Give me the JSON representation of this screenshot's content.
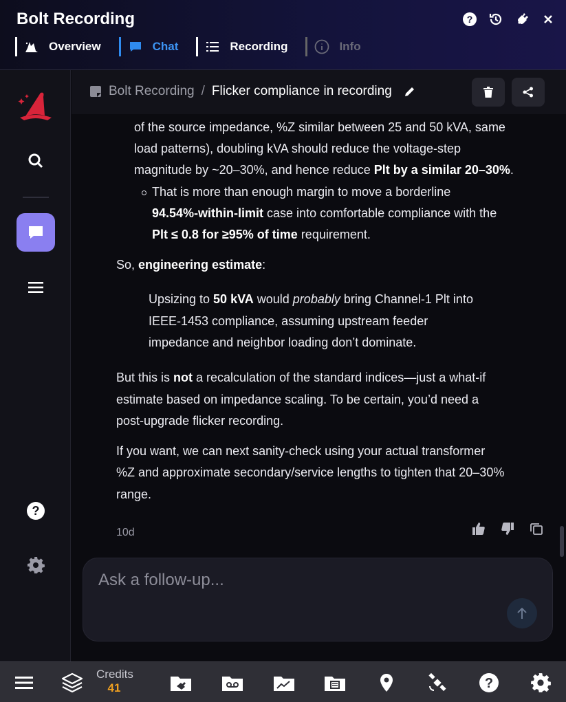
{
  "header": {
    "title": "Bolt Recording",
    "tabs": [
      {
        "label": "Overview",
        "icon": "wizard-hat-icon"
      },
      {
        "label": "Chat",
        "icon": "chat-bubble-icon"
      },
      {
        "label": "Recording",
        "icon": "list-icon"
      },
      {
        "label": "Info",
        "icon": "info-icon"
      }
    ],
    "icons": [
      "help-icon",
      "history-icon",
      "plug-icon",
      "close-icon"
    ]
  },
  "sidebar": {
    "items": [
      "logo-hat-icon",
      "search-icon",
      "chat-icon",
      "menu-icon",
      "help-icon",
      "settings-icon"
    ]
  },
  "breadcrumb": {
    "root": "Bolt Recording",
    "separator": "/",
    "current": "Flicker compliance in recording"
  },
  "message": {
    "l1": "of the source impedance, %Z similar between 25 and 50 kVA, same",
    "l2": "load patterns), doubling kVA should reduce the voltage-step",
    "l3a": "magnitude by ~20–30%, and hence reduce ",
    "l3b": "Plt by a similar 20–30%",
    "l3c": ".",
    "b1": "That is more than enough margin to move a borderline",
    "b2a": "94.54%-within-limit",
    "b2b": " case into comfortable compliance with the",
    "b3a": "Plt ≤ 0.8 for ≥95% of time",
    "b3b": " requirement.",
    "so_a": "So, ",
    "so_b": "engineering estimate",
    "so_c": ":",
    "q1a": "Upsizing to ",
    "q1b": "50 kVA",
    "q1c": " would ",
    "q1d": "probably",
    "q1e": " bring Channel-1 Plt into",
    "q2": "IEEE-1453 compliance, assuming upstream feeder",
    "q3": "impedance and neighbor loading don’t dominate.",
    "p1a": "But this is ",
    "p1b": "not",
    "p1c": " a recalculation of the standard indices—just a what-if",
    "p2": "estimate based on impedance scaling. To be certain, you’d need a",
    "p3": "post-upgrade flicker recording.",
    "p4": "If you want, we can next sanity-check using your actual transformer",
    "p5": "%Z and approximate secondary/service lengths to tighten that 20–30%",
    "p6": "range.",
    "age": "10d"
  },
  "input": {
    "placeholder": "Ask a follow-up..."
  },
  "bottombar": {
    "credits_label": "Credits",
    "credits_value": "41"
  },
  "colors": {
    "accent": "#3d95f5",
    "sidebar_active": "#8a7ff0",
    "credits": "#f0a020",
    "logo": "#d8243a"
  }
}
